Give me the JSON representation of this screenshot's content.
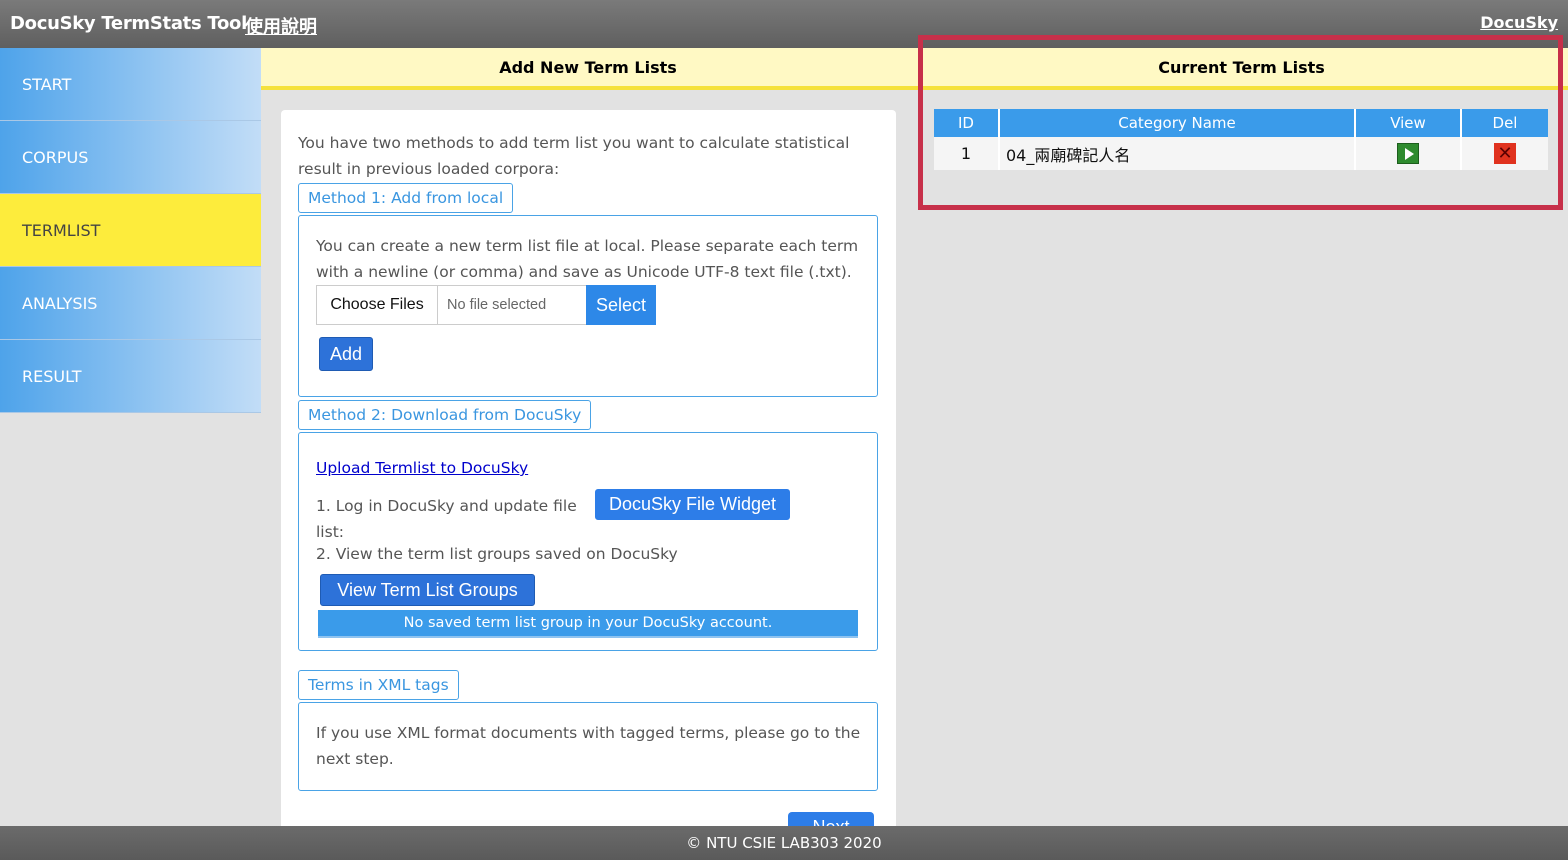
{
  "topbar": {
    "brand": "DocuSky TermStats Tool",
    "manual_link": "使用說明",
    "docusky_link": "DocuSky"
  },
  "sidebar": {
    "items": [
      {
        "label": "START"
      },
      {
        "label": "CORPUS"
      },
      {
        "label": "TERMLIST",
        "active": true
      },
      {
        "label": "ANALYSIS"
      },
      {
        "label": "RESULT"
      }
    ]
  },
  "add_section": {
    "header": "Add New Term Lists",
    "intro": "You have two methods to add term list you want to calculate statistical result in previous loaded corpora:",
    "method1": {
      "tag": "Method 1: Add from local",
      "description": "You can create a new term list file at local. Please separate each term with a newline (or comma) and save as Unicode UTF-8 text file (.txt).",
      "choose_files": "Choose Files",
      "no_file": "No file selected",
      "select": "Select",
      "add": "Add"
    },
    "method2": {
      "tag": "Method 2: Download from DocuSky",
      "upload_link": "Upload Termlist to DocuSky",
      "step1": "1. Log in DocuSky and update file list:",
      "widget_button": "DocuSky File Widget",
      "step2": "2. View the term list groups saved on DocuSky",
      "view_groups_button": "View Term List Groups",
      "no_saved": "No saved term list group in your DocuSky account."
    },
    "xml": {
      "tag": "Terms in XML tags",
      "description": "If you use XML format documents with tagged terms, please go to the next step."
    },
    "next_button": "Next"
  },
  "current_section": {
    "header": "Current Term Lists",
    "columns": [
      "ID",
      "Category Name",
      "View",
      "Del"
    ],
    "rows": [
      {
        "id": "1",
        "name": "04_兩廟碑記人名",
        "view_icon": "play-icon",
        "del_icon": "close-icon"
      }
    ]
  },
  "colors": {
    "highlight": "#c7304a",
    "accent": "#3a9bea",
    "active_nav": "#fdec3c"
  },
  "footer": {
    "text": "© NTU CSIE LAB303 2020"
  }
}
